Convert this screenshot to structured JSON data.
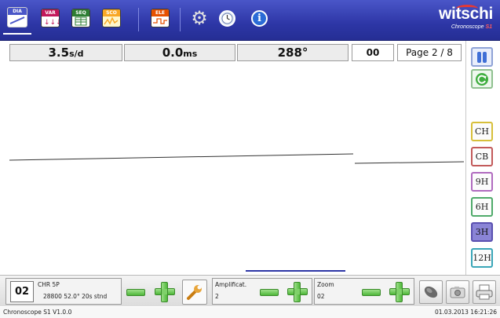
{
  "toolbar": {
    "icons": [
      {
        "name": "dia",
        "label": "DIA",
        "color": "#4a56c8"
      },
      {
        "name": "var",
        "label": "VAR",
        "color": "#c2185b"
      },
      {
        "name": "seq",
        "label": "SEQ",
        "color": "#2e7d32"
      },
      {
        "name": "sco",
        "label": "SCO",
        "color": "#f9a825"
      },
      {
        "name": "ele",
        "label": "ELE",
        "color": "#e65100"
      }
    ],
    "settings_icon": "gear-icon",
    "clock_icon": "clock-icon",
    "info_icon": "info-icon",
    "info_glyph": "i",
    "brand": {
      "name": "witschi",
      "sub_prefix": "Chronoscope ",
      "sub_model": "S1"
    }
  },
  "readouts": {
    "rate": {
      "value": "3.5",
      "unit": "s/d"
    },
    "amplitude": {
      "value": "0.0",
      "unit": "ms"
    },
    "angle": {
      "value": "288°"
    },
    "index": "00",
    "page": "Page 2 / 8"
  },
  "sidebar": {
    "pause_icon": "pause-icon",
    "refresh_icon": "refresh-icon",
    "positions": [
      {
        "label": "CH",
        "color": "#d7bf3a",
        "selected": false
      },
      {
        "label": "CB",
        "color": "#c25a5a",
        "selected": false
      },
      {
        "label": "9H",
        "color": "#b06bbf",
        "selected": false
      },
      {
        "label": "6H",
        "color": "#4faa6a",
        "selected": false
      },
      {
        "label": "3H",
        "color": "#5a50b0",
        "selected": true
      },
      {
        "label": "12H",
        "color": "#3aa6b8",
        "selected": false
      }
    ]
  },
  "trace": {
    "color": "#333333",
    "scroll_indicator_color": "#2d36a6"
  },
  "bottombar": {
    "program_number": "02",
    "program_name": "CHR 5P",
    "program_details": "28800 52.0° 20s stnd",
    "amplification": {
      "label": "Amplificat.",
      "value": "2"
    },
    "zoom": {
      "label": "Zoom",
      "value": "02"
    },
    "wrench_icon": "wrench-icon",
    "speaker_icon": "speaker-icon",
    "camera_icon": "camera-icon",
    "printer_icon": "printer-icon"
  },
  "status": {
    "version": "Chronoscope S1 V1.0.0",
    "timestamp": "01.03.2013 16:21:26"
  }
}
